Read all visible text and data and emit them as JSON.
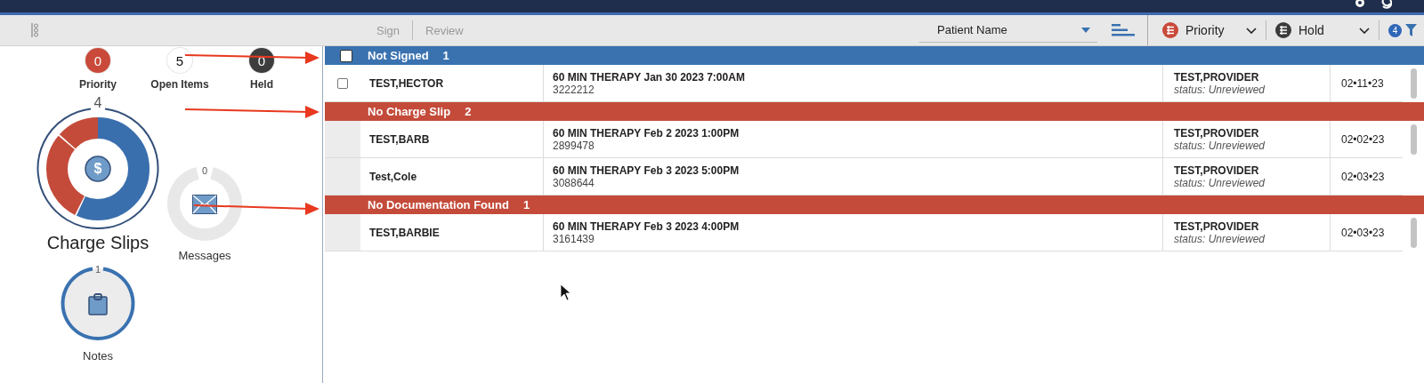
{
  "toolbar": {
    "actions": [
      {
        "label": "Sign",
        "disabled": true
      },
      {
        "label": "Review",
        "disabled": true
      }
    ],
    "sort_field": {
      "value": "Patient Name"
    },
    "filters": [
      {
        "label": "Priority",
        "color": "#c94a3a"
      },
      {
        "label": "Hold",
        "color": "#3b3b3b"
      }
    ],
    "filter_count": "4"
  },
  "summary": {
    "counters": [
      {
        "label": "Priority",
        "count": "0",
        "color": "#c94a3a"
      },
      {
        "label": "Open Items",
        "count": "5",
        "color": "#ffffff"
      },
      {
        "label": "Held",
        "count": "0",
        "color": "#3d3d3d"
      }
    ]
  },
  "widgets": {
    "charge_slips": {
      "label": "Charge Slips",
      "count": "4",
      "icon": "$"
    },
    "messages": {
      "label": "Messages",
      "count": "0"
    },
    "notes": {
      "label": "Notes",
      "count": "1"
    }
  },
  "groups": [
    {
      "title": "Not Signed",
      "count": "1",
      "color": "#3a72b0",
      "checked": false,
      "rows": [
        {
          "patient": "TEST,HECTOR",
          "checked": false,
          "item": "60 MIN THERAPY Jan 30 2023 7:00AM",
          "number": "3222212",
          "provider": "TEST,PROVIDER",
          "status": "status: Unreviewed",
          "date": "02•11•23"
        }
      ]
    },
    {
      "title": "No Charge Slip",
      "count": "2",
      "color": "#c44b3a",
      "rows": [
        {
          "patient": "TEST,BARB",
          "item": "60 MIN THERAPY Feb 2 2023 1:00PM",
          "number": "2899478",
          "provider": "TEST,PROVIDER",
          "status": "status: Unreviewed",
          "date": "02•02•23"
        },
        {
          "patient": "Test,Cole",
          "item": "60 MIN THERAPY Feb 3 2023 5:00PM",
          "number": "3088644",
          "provider": "TEST,PROVIDER",
          "status": "status: Unreviewed",
          "date": "02•03•23"
        }
      ]
    },
    {
      "title": "No Documentation Found",
      "count": "1",
      "color": "#c44b3a",
      "rows": [
        {
          "patient": "TEST,BARBIE",
          "item": "60 MIN THERAPY Feb 3 2023 4:00PM",
          "number": "3161439",
          "provider": "TEST,PROVIDER",
          "status": "status: Unreviewed",
          "date": "02•03•23"
        }
      ]
    }
  ]
}
